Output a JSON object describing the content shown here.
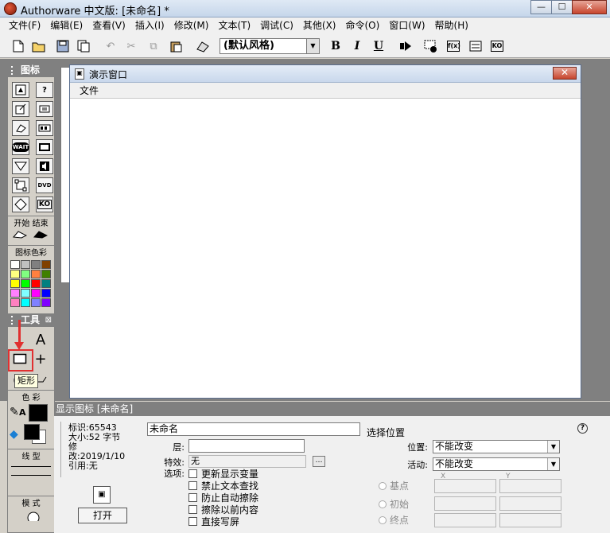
{
  "window": {
    "title": "Authorware 中文版: [未命名] *",
    "minimize": "—",
    "maximize": "☐",
    "close": "✕"
  },
  "menu": [
    "文件(F)",
    "编辑(E)",
    "查看(V)",
    "插入(I)",
    "修改(M)",
    "文本(T)",
    "调试(C)",
    "其他(X)",
    "命令(O)",
    "窗口(W)",
    "帮助(H)"
  ],
  "toolbar": {
    "style_value": "(默认风格)",
    "bold": "B",
    "italic": "I",
    "underline": "U",
    "fn_label": "f(x)",
    "ko_label": "KO"
  },
  "palette": {
    "title": "图标",
    "wait_label": "WAIT",
    "dvd_label": "DVD",
    "ko_label": "KO",
    "start_end": "开始 结束",
    "color_label": "图标色彩",
    "colors": [
      "#ffffff",
      "#c0c0c0",
      "#808080",
      "#804000",
      "#ffff80",
      "#80ff80",
      "#ff8040",
      "#408000",
      "#ffff00",
      "#00ff00",
      "#ff0000",
      "#008080",
      "#ff80ff",
      "#80ffff",
      "#ff00ff",
      "#0000ff",
      "#ff80c0",
      "#00ffff",
      "#8080ff",
      "#8000ff"
    ]
  },
  "tools": {
    "title": "工具",
    "text_tool": "A",
    "rect_tool": "□",
    "plus_tool": "+",
    "color_label": "色 彩",
    "line_label": "线 型",
    "mode_label": "模 式",
    "tooltip": "矩形"
  },
  "demo_window": {
    "title": "演示窗口",
    "menu_item": "文件",
    "close": "✕"
  },
  "properties": {
    "header": "显示图标 [未命名]",
    "info_id": "标识:65543",
    "info_size": "大小:52 字节",
    "info_modified": "修改:2019/1/10",
    "info_ref": "引用:无",
    "name_value": "未命名",
    "layer_label": "层:",
    "effect_label": "特效:",
    "effect_value": "无",
    "options_label": "选项:",
    "options": [
      "更新显示变量",
      "禁止文本查找",
      "防止自动擦除",
      "擦除以前内容",
      "直接写屏"
    ],
    "open_button": "打开",
    "select_position": "选择位置",
    "position_label": "位置:",
    "position_value": "不能改变",
    "activity_label": "活动:",
    "activity_value": "不能改变",
    "base_label": "基点",
    "initial_label": "初始",
    "end_label": "终点",
    "x_label": "X",
    "y_label": "Y",
    "help": "?"
  }
}
